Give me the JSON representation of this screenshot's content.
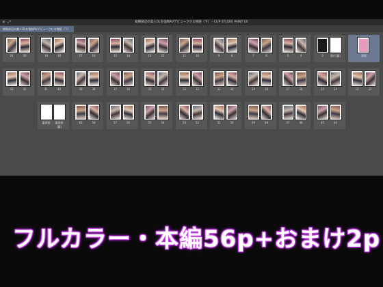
{
  "window": {
    "title": "総務部辺の美人OLを強制AVデビューさせる物語（下） - CLIP STUDIO PAINT EX",
    "tab_label": "総務部辺の美人OLを強制AVデビューさせる物語（下）"
  },
  "rows": [
    [
      {
        "left": "21",
        "right": "20"
      },
      {
        "left": "19",
        "right": "18"
      },
      {
        "left": "17",
        "right": "16"
      },
      {
        "left": "15",
        "right": "14"
      },
      {
        "left": "13",
        "right": "12"
      },
      {
        "left": "11",
        "right": "10"
      },
      {
        "left": "9",
        "right": "8"
      },
      {
        "left": "7",
        "right": "6"
      },
      {
        "left": "5",
        "right": "4"
      },
      {
        "left": "3",
        "right": "奥付(裏)"
      },
      {
        "single": "表紙"
      }
    ],
    [
      {
        "left": "43",
        "right": "42"
      },
      {
        "left": "41",
        "right": "40"
      },
      {
        "left": "39",
        "right": "38"
      },
      {
        "left": "37",
        "right": "36"
      },
      {
        "left": "35",
        "right": "34"
      },
      {
        "left": "33",
        "right": "32"
      },
      {
        "left": "31",
        "right": "30"
      },
      {
        "left": "29",
        "right": "28"
      },
      {
        "left": "27",
        "right": "26"
      },
      {
        "left": "25",
        "right": "24"
      },
      {
        "left": "23",
        "right": "22"
      }
    ],
    [
      {
        "left": "裏表紙",
        "right": "裏表紙(裏)"
      },
      {
        "left": "63",
        "right": "58"
      },
      {
        "left": "57",
        "right": "56"
      },
      {
        "left": "55",
        "right": "54"
      },
      {
        "left": "53",
        "right": "52"
      },
      {
        "left": "51",
        "right": "50"
      },
      {
        "left": "49",
        "right": "48"
      },
      {
        "left": "47",
        "right": "46"
      },
      {
        "left": "45",
        "right": "44"
      }
    ]
  ],
  "caption": "フルカラー・本編56p+おまけ2p"
}
